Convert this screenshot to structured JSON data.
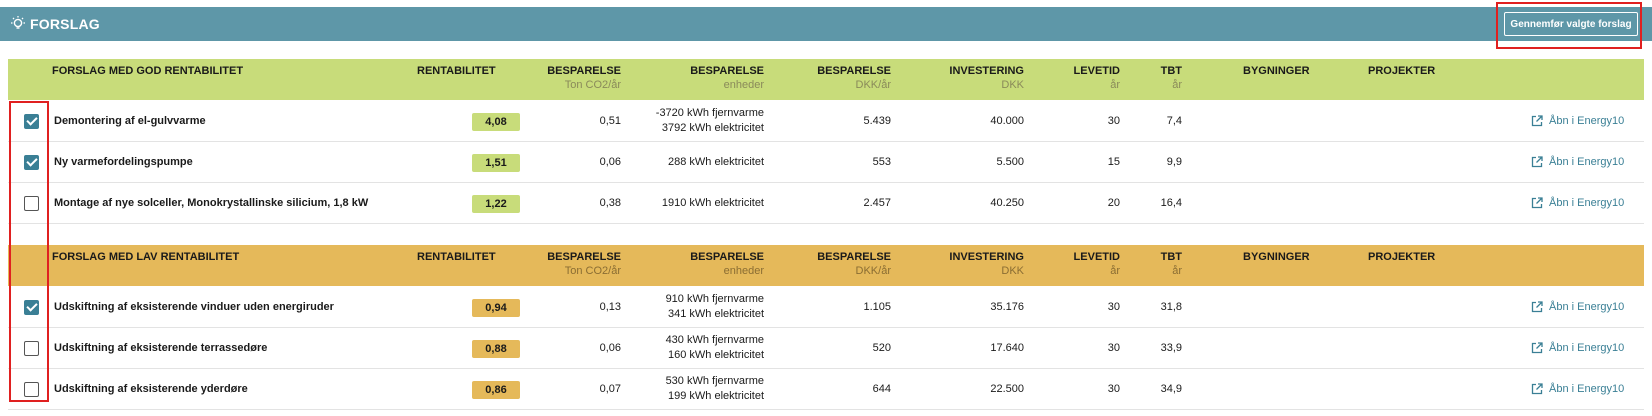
{
  "header": {
    "title": "FORSLAG",
    "action_button": "Gennemfør valgte forslag"
  },
  "columns": {
    "rentabilitet": "RENTABILITET",
    "besparelse": "BESPARELSE",
    "co2_unit": "Ton CO2/år",
    "enheder_unit": "enheder",
    "dkk_year_unit": "DKK/år",
    "investering": "INVESTERING",
    "dkk_unit": "DKK",
    "levetid": "LEVETID",
    "aar_unit": "år",
    "tbt": "TBT",
    "bygninger": "BYGNINGER",
    "projekter": "PROJEKTER"
  },
  "good_group": {
    "title": "FORSLAG MED GOD RENTABILITET",
    "rows": [
      {
        "checked": true,
        "name": "Demontering af el-gulvvarme",
        "rentabilitet": "4,08",
        "co2": "0,51",
        "enheder_1": "-3720 kWh fjernvarme",
        "enheder_2": "3792 kWh elektricitet",
        "dkk_aar": "5.439",
        "investering": "40.000",
        "levetid": "30",
        "tbt": "7,4",
        "link": "Åbn i Energy10"
      },
      {
        "checked": true,
        "name": "Ny varmefordelingspumpe",
        "rentabilitet": "1,51",
        "co2": "0,06",
        "enheder_1": "288 kWh elektricitet",
        "enheder_2": "",
        "dkk_aar": "553",
        "investering": "5.500",
        "levetid": "15",
        "tbt": "9,9",
        "link": "Åbn i Energy10"
      },
      {
        "checked": false,
        "name": "Montage af nye solceller, Monokrystallinske silicium, 1,8 kW",
        "rentabilitet": "1,22",
        "co2": "0,38",
        "enheder_1": "1910 kWh elektricitet",
        "enheder_2": "",
        "dkk_aar": "2.457",
        "investering": "40.250",
        "levetid": "20",
        "tbt": "16,4",
        "link": "Åbn i Energy10"
      }
    ]
  },
  "low_group": {
    "title": "FORSLAG MED LAV RENTABILITET",
    "rows": [
      {
        "checked": true,
        "name": "Udskiftning af eksisterende vinduer uden energiruder",
        "rentabilitet": "0,94",
        "co2": "0,13",
        "enheder_1": "910 kWh fjernvarme",
        "enheder_2": "341 kWh elektricitet",
        "dkk_aar": "1.105",
        "investering": "35.176",
        "levetid": "30",
        "tbt": "31,8",
        "link": "Åbn i Energy10"
      },
      {
        "checked": false,
        "name": "Udskiftning af eksisterende terrassedøre",
        "rentabilitet": "0,88",
        "co2": "0,06",
        "enheder_1": "430 kWh fjernvarme",
        "enheder_2": "160 kWh elektricitet",
        "dkk_aar": "520",
        "investering": "17.640",
        "levetid": "30",
        "tbt": "33,9",
        "link": "Åbn i Energy10"
      },
      {
        "checked": false,
        "name": "Udskiftning af eksisterende yderdøre",
        "rentabilitet": "0,86",
        "co2": "0,07",
        "enheder_1": "530 kWh fjernvarme",
        "enheder_2": "199 kWh elektricitet",
        "dkk_aar": "644",
        "investering": "22.500",
        "levetid": "30",
        "tbt": "34,9",
        "link": "Åbn i Energy10"
      }
    ]
  },
  "colors": {
    "topbar": "#5e97a8",
    "good": "#c8dc7a",
    "low": "#e5b95a",
    "accent": "#3a7f95",
    "highlight": "#e02020"
  }
}
